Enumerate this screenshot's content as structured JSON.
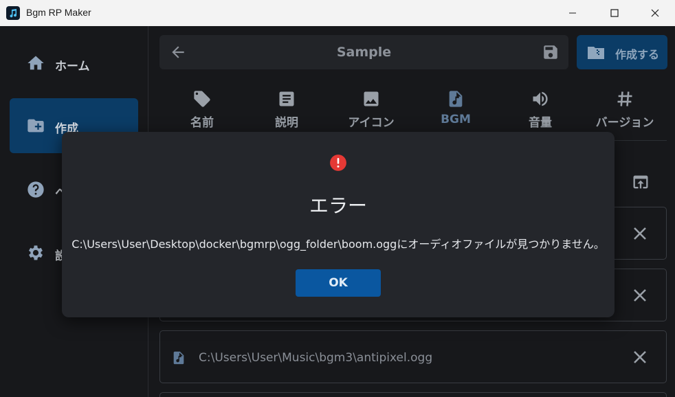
{
  "window": {
    "title": "Bgm RP Maker",
    "controls": {
      "minimize": "minimize-icon",
      "maximize": "maximize-icon",
      "close": "close-icon"
    }
  },
  "sidebar": {
    "items": [
      {
        "label": "ホーム",
        "icon": "home-icon",
        "active": false
      },
      {
        "label": "作成",
        "icon": "folder-add-icon",
        "active": true
      },
      {
        "label": "ヘ",
        "icon": "help-icon",
        "active": false
      },
      {
        "label": "設",
        "icon": "gear-icon",
        "active": false
      }
    ]
  },
  "header": {
    "title": "Sample",
    "create_label": "作成する"
  },
  "tabs": [
    {
      "label": "名前",
      "icon": "tag-icon"
    },
    {
      "label": "説明",
      "icon": "document-icon"
    },
    {
      "label": "アイコン",
      "icon": "image-icon"
    },
    {
      "label": "BGM",
      "icon": "music-file-icon",
      "active": true
    },
    {
      "label": "音量",
      "icon": "volume-icon"
    },
    {
      "label": "バージョン",
      "icon": "hash-icon"
    }
  ],
  "files": [
    {
      "path": ""
    },
    {
      "path": ""
    },
    {
      "path": "C:\\Users\\User\\Music\\bgm3\\antipixel.ogg"
    }
  ],
  "dialog": {
    "title": "エラー",
    "message": "C:\\Users\\User\\Desktop\\docker\\bgmrp\\ogg_folder\\boom.oggにオーディオファイルが見つかりません。",
    "ok_label": "OK",
    "icon_color": "#e53935"
  },
  "colors": {
    "accent": "#0b3c66",
    "ok_button": "#0a57a0",
    "background": "#17181b"
  }
}
